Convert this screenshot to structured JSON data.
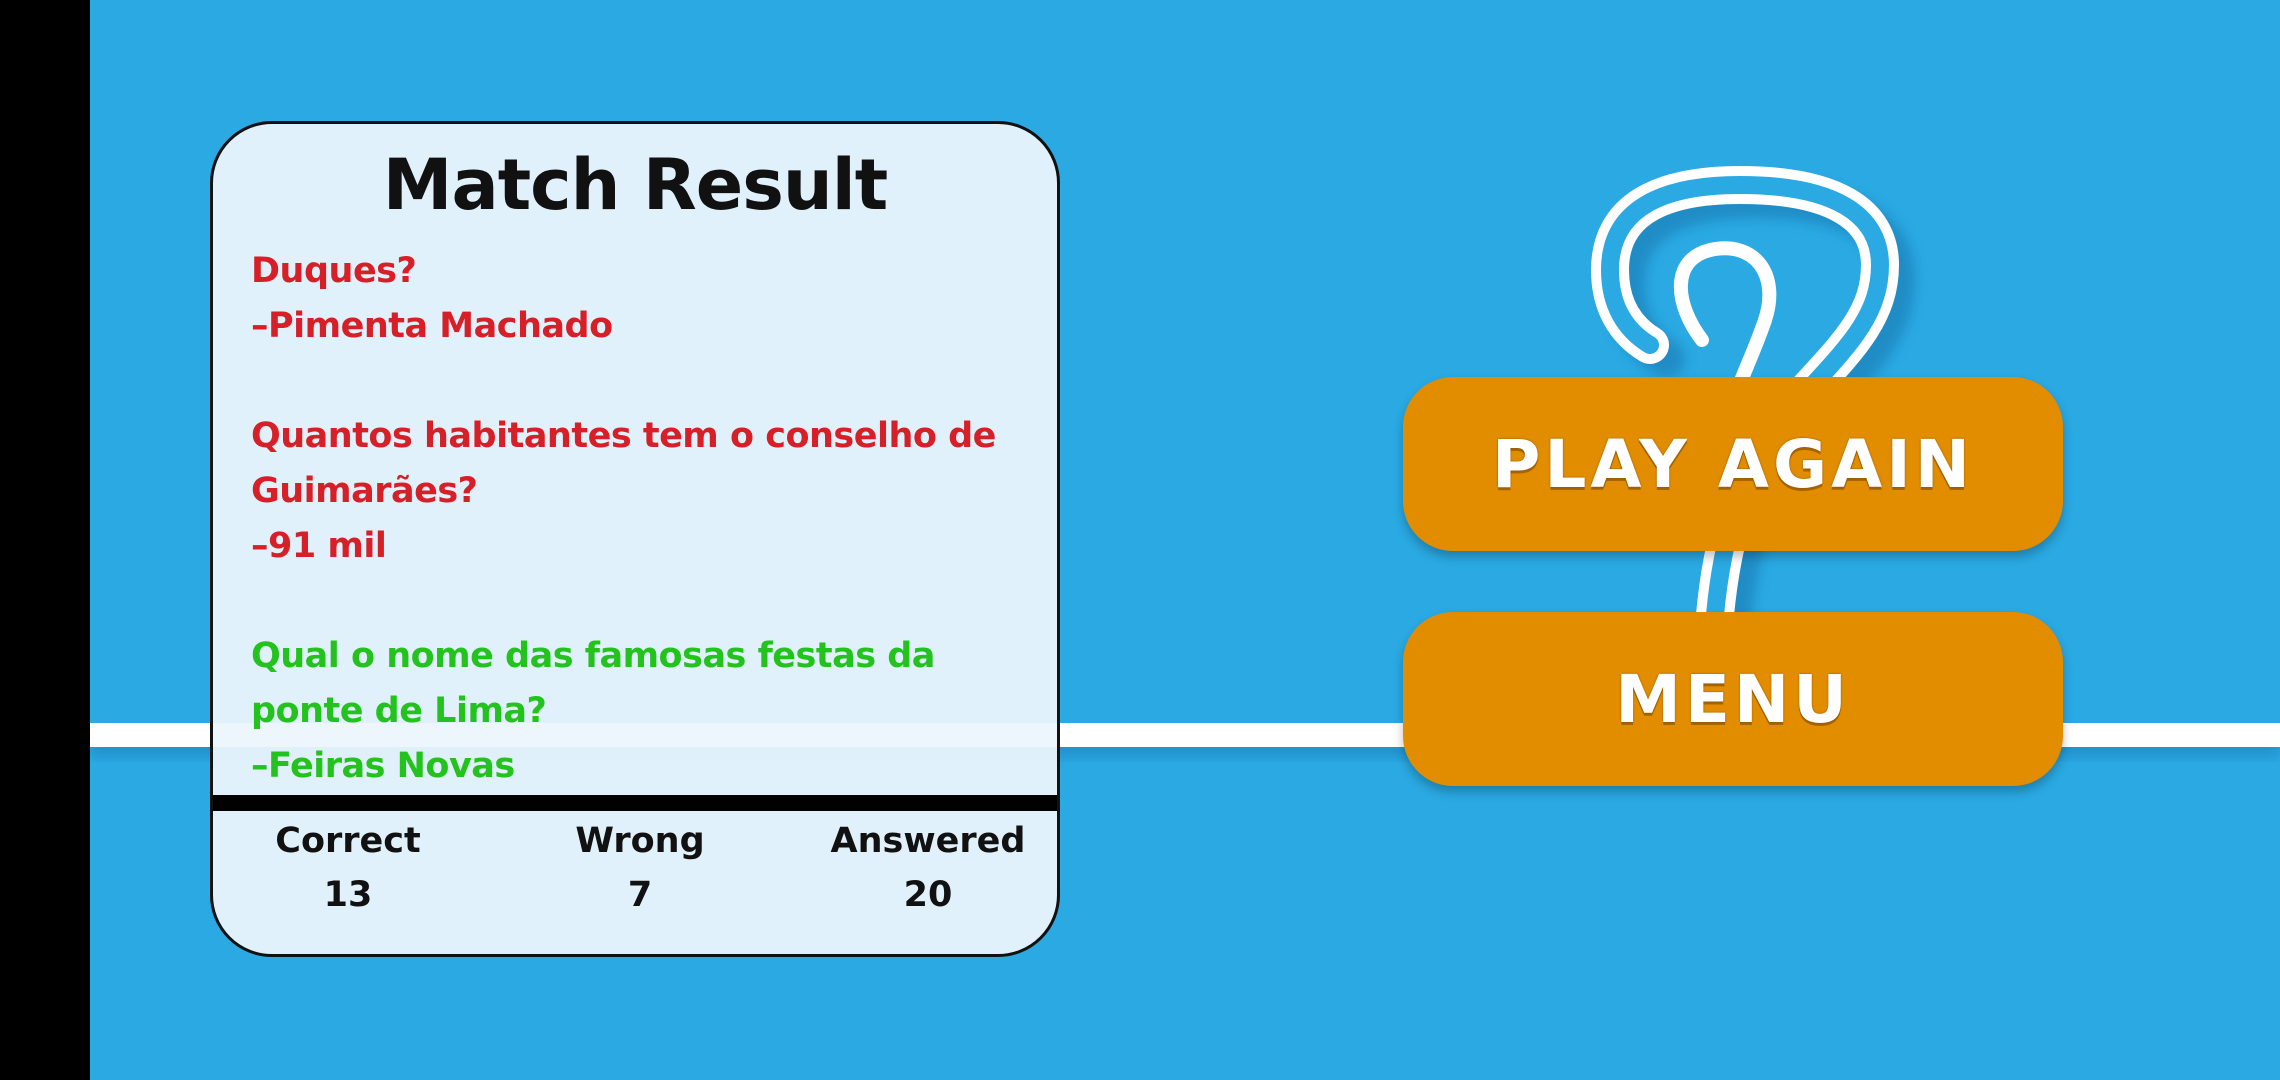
{
  "colors": {
    "background": "#2aa9e3",
    "card": "#ecf5fc",
    "wrong_answer": "#d61f26",
    "correct_answer": "#23c21d",
    "button": "#e28d00",
    "button_text": "#ffffff"
  },
  "result": {
    "title": "Match Result",
    "questions": [
      {
        "status": "wrong",
        "lines": [
          "Duques?",
          "–Pimenta Machado"
        ]
      },
      {
        "status": "wrong",
        "lines": [
          "Quantos habitantes tem o conselho de",
          "Guimarães?",
          "–91 mil"
        ]
      },
      {
        "status": "correct",
        "lines": [
          "Qual o nome das famosas festas da",
          "ponte de Lima?",
          "–Feiras Novas"
        ]
      }
    ],
    "stats": {
      "correct_label": "Correct",
      "correct_value": "13",
      "wrong_label": "Wrong",
      "wrong_value": "7",
      "answered_label": "Answered",
      "answered_value": "20"
    }
  },
  "buttons": {
    "play_again": "PLAY AGAIN",
    "menu": "MENU"
  },
  "icons": {
    "background_mark": "question-mark-icon"
  }
}
